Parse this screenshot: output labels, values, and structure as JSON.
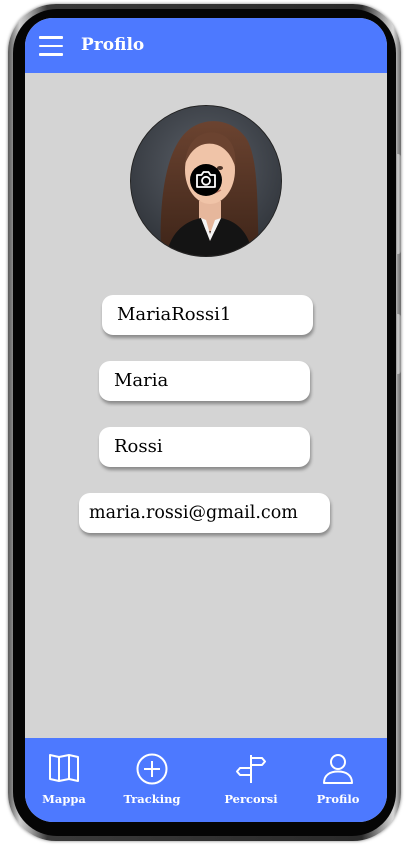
{
  "header": {
    "title": "Profilo",
    "menu_icon": "hamburger-menu-icon"
  },
  "profile": {
    "avatar_icon": "user-photo",
    "camera_icon": "camera-icon",
    "username": "MariaRossi1",
    "first_name": "Maria",
    "last_name": "Rossi",
    "email": "maria.rossi@gmail.com"
  },
  "bottom_nav": {
    "items": [
      {
        "label": "Mappa",
        "icon": "map-icon"
      },
      {
        "label": "Tracking",
        "icon": "plus-circle-icon"
      },
      {
        "label": "Percorsi",
        "icon": "signpost-icon"
      },
      {
        "label": "Profilo",
        "icon": "user-icon"
      }
    ]
  },
  "colors": {
    "accent": "#4d79ff",
    "background": "#d4d4d4",
    "field_background": "#ffffff",
    "text": "#000000"
  }
}
